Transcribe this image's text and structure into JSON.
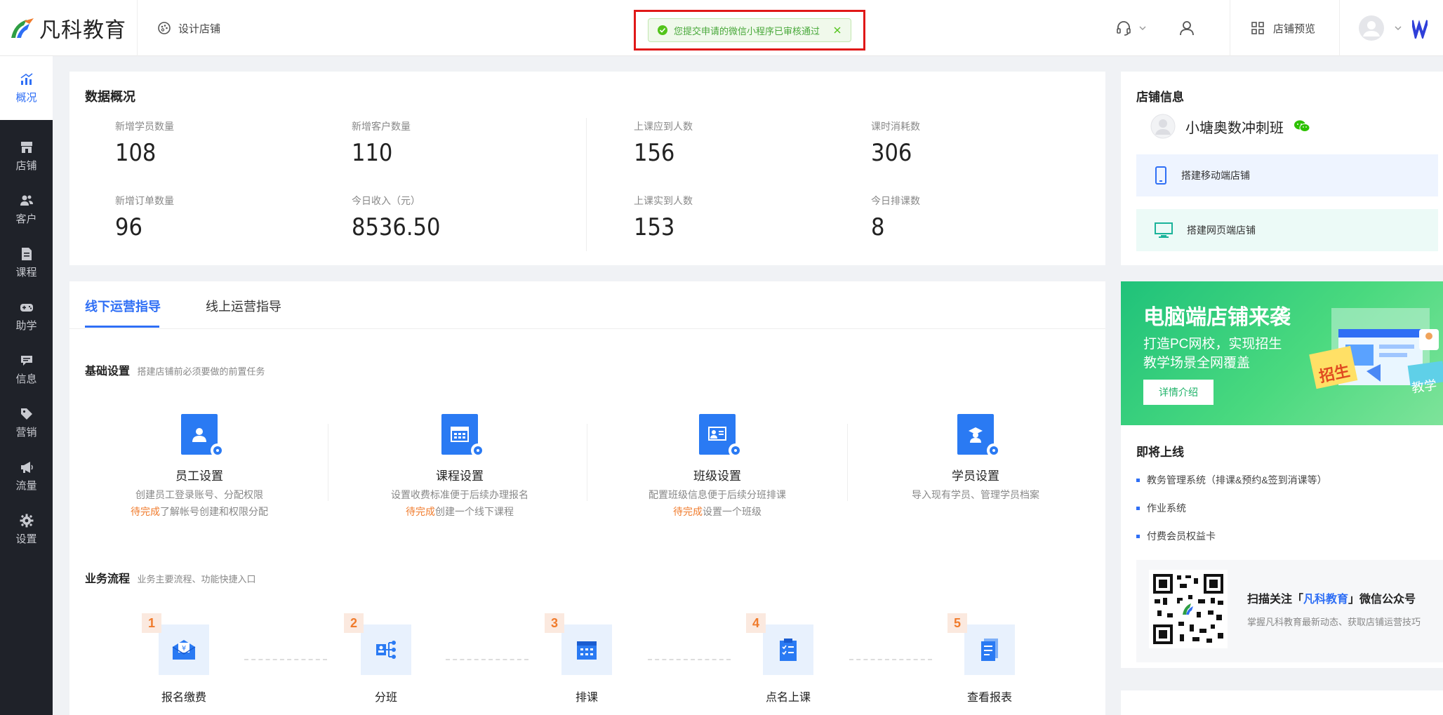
{
  "brand": {
    "name": "凡科教育"
  },
  "header": {
    "design_label": "设计店铺",
    "notice": "您提交申请的微信小程序已审核通过",
    "preview_label": "店铺预览"
  },
  "sidebar": {
    "items": [
      {
        "label": "概况",
        "icon": "chart-icon",
        "active": true
      },
      {
        "label": "店铺",
        "icon": "store-icon"
      },
      {
        "label": "客户",
        "icon": "users-icon"
      },
      {
        "label": "课程",
        "icon": "document-icon"
      },
      {
        "label": "助学",
        "icon": "gamepad-icon"
      },
      {
        "label": "信息",
        "icon": "message-icon"
      },
      {
        "label": "营销",
        "icon": "tag-icon"
      },
      {
        "label": "流量",
        "icon": "megaphone-icon"
      },
      {
        "label": "设置",
        "icon": "gear-icon"
      }
    ]
  },
  "overview": {
    "title": "数据概况",
    "stats": [
      {
        "label": "新增学员数量",
        "value": "108"
      },
      {
        "label": "新增客户数量",
        "value": "110"
      },
      {
        "label": "上课应到人数",
        "value": "156"
      },
      {
        "label": "课时消耗数",
        "value": "306"
      },
      {
        "label": "新增订单数量",
        "value": "96"
      },
      {
        "label": "今日收入（元）",
        "value": "8536.50"
      },
      {
        "label": "上课实到人数",
        "value": "153"
      },
      {
        "label": "今日排课数",
        "value": "8"
      }
    ]
  },
  "guide": {
    "tabs": [
      {
        "label": "线下运营指导",
        "active": true
      },
      {
        "label": "线上运营指导"
      }
    ],
    "basic": {
      "title": "基础设置",
      "subtitle": "搭建店铺前必须要做的前置任务",
      "items": [
        {
          "name": "员工设置",
          "desc": "创建员工登录账号、分配权限",
          "todo": "待完成",
          "todo_rest": "了解帐号创建和权限分配"
        },
        {
          "name": "课程设置",
          "desc": "设置收费标准便于后续办理报名",
          "todo": "待完成",
          "todo_rest": "创建一个线下课程"
        },
        {
          "name": "班级设置",
          "desc": "配置班级信息便于后续分班排课",
          "todo": "待完成",
          "todo_rest": "设置一个班级"
        },
        {
          "name": "学员设置",
          "desc": "导入现有学员、管理学员档案",
          "todo": "",
          "todo_rest": ""
        }
      ]
    },
    "flow": {
      "title": "业务流程",
      "subtitle": "业务主要流程、功能快捷入口",
      "steps": [
        {
          "num": "1",
          "label": "报名缴费"
        },
        {
          "num": "2",
          "label": "分班"
        },
        {
          "num": "3",
          "label": "排课"
        },
        {
          "num": "4",
          "label": "点名上课"
        },
        {
          "num": "5",
          "label": "查看报表"
        }
      ]
    }
  },
  "store": {
    "title": "店铺信息",
    "name": "小塘奥数冲刺班",
    "mobile_label": "搭建移动端店铺",
    "web_label": "搭建网页端店铺"
  },
  "banner": {
    "title": "电脑端店铺来袭",
    "line1": "打造PC网校，实现招生",
    "line2": "教学场景全网覆盖",
    "button": "详情介绍",
    "tag_left": "招生",
    "tag_right": "教学"
  },
  "soon": {
    "title": "即将上线",
    "items": [
      "教务管理系统（排课&预约&签到消课等）",
      "作业系统",
      "付费会员权益卡"
    ]
  },
  "qr": {
    "prefix": "扫描关注「",
    "brand": "凡科教育",
    "suffix": "」微信公众号",
    "desc": "掌握凡科教育最新动态、获取店铺运营技巧"
  },
  "colors": {
    "accent": "#2f6ff5",
    "sidebar": "#1f2229",
    "todo": "#f07b2c",
    "success": "#52c41a"
  }
}
